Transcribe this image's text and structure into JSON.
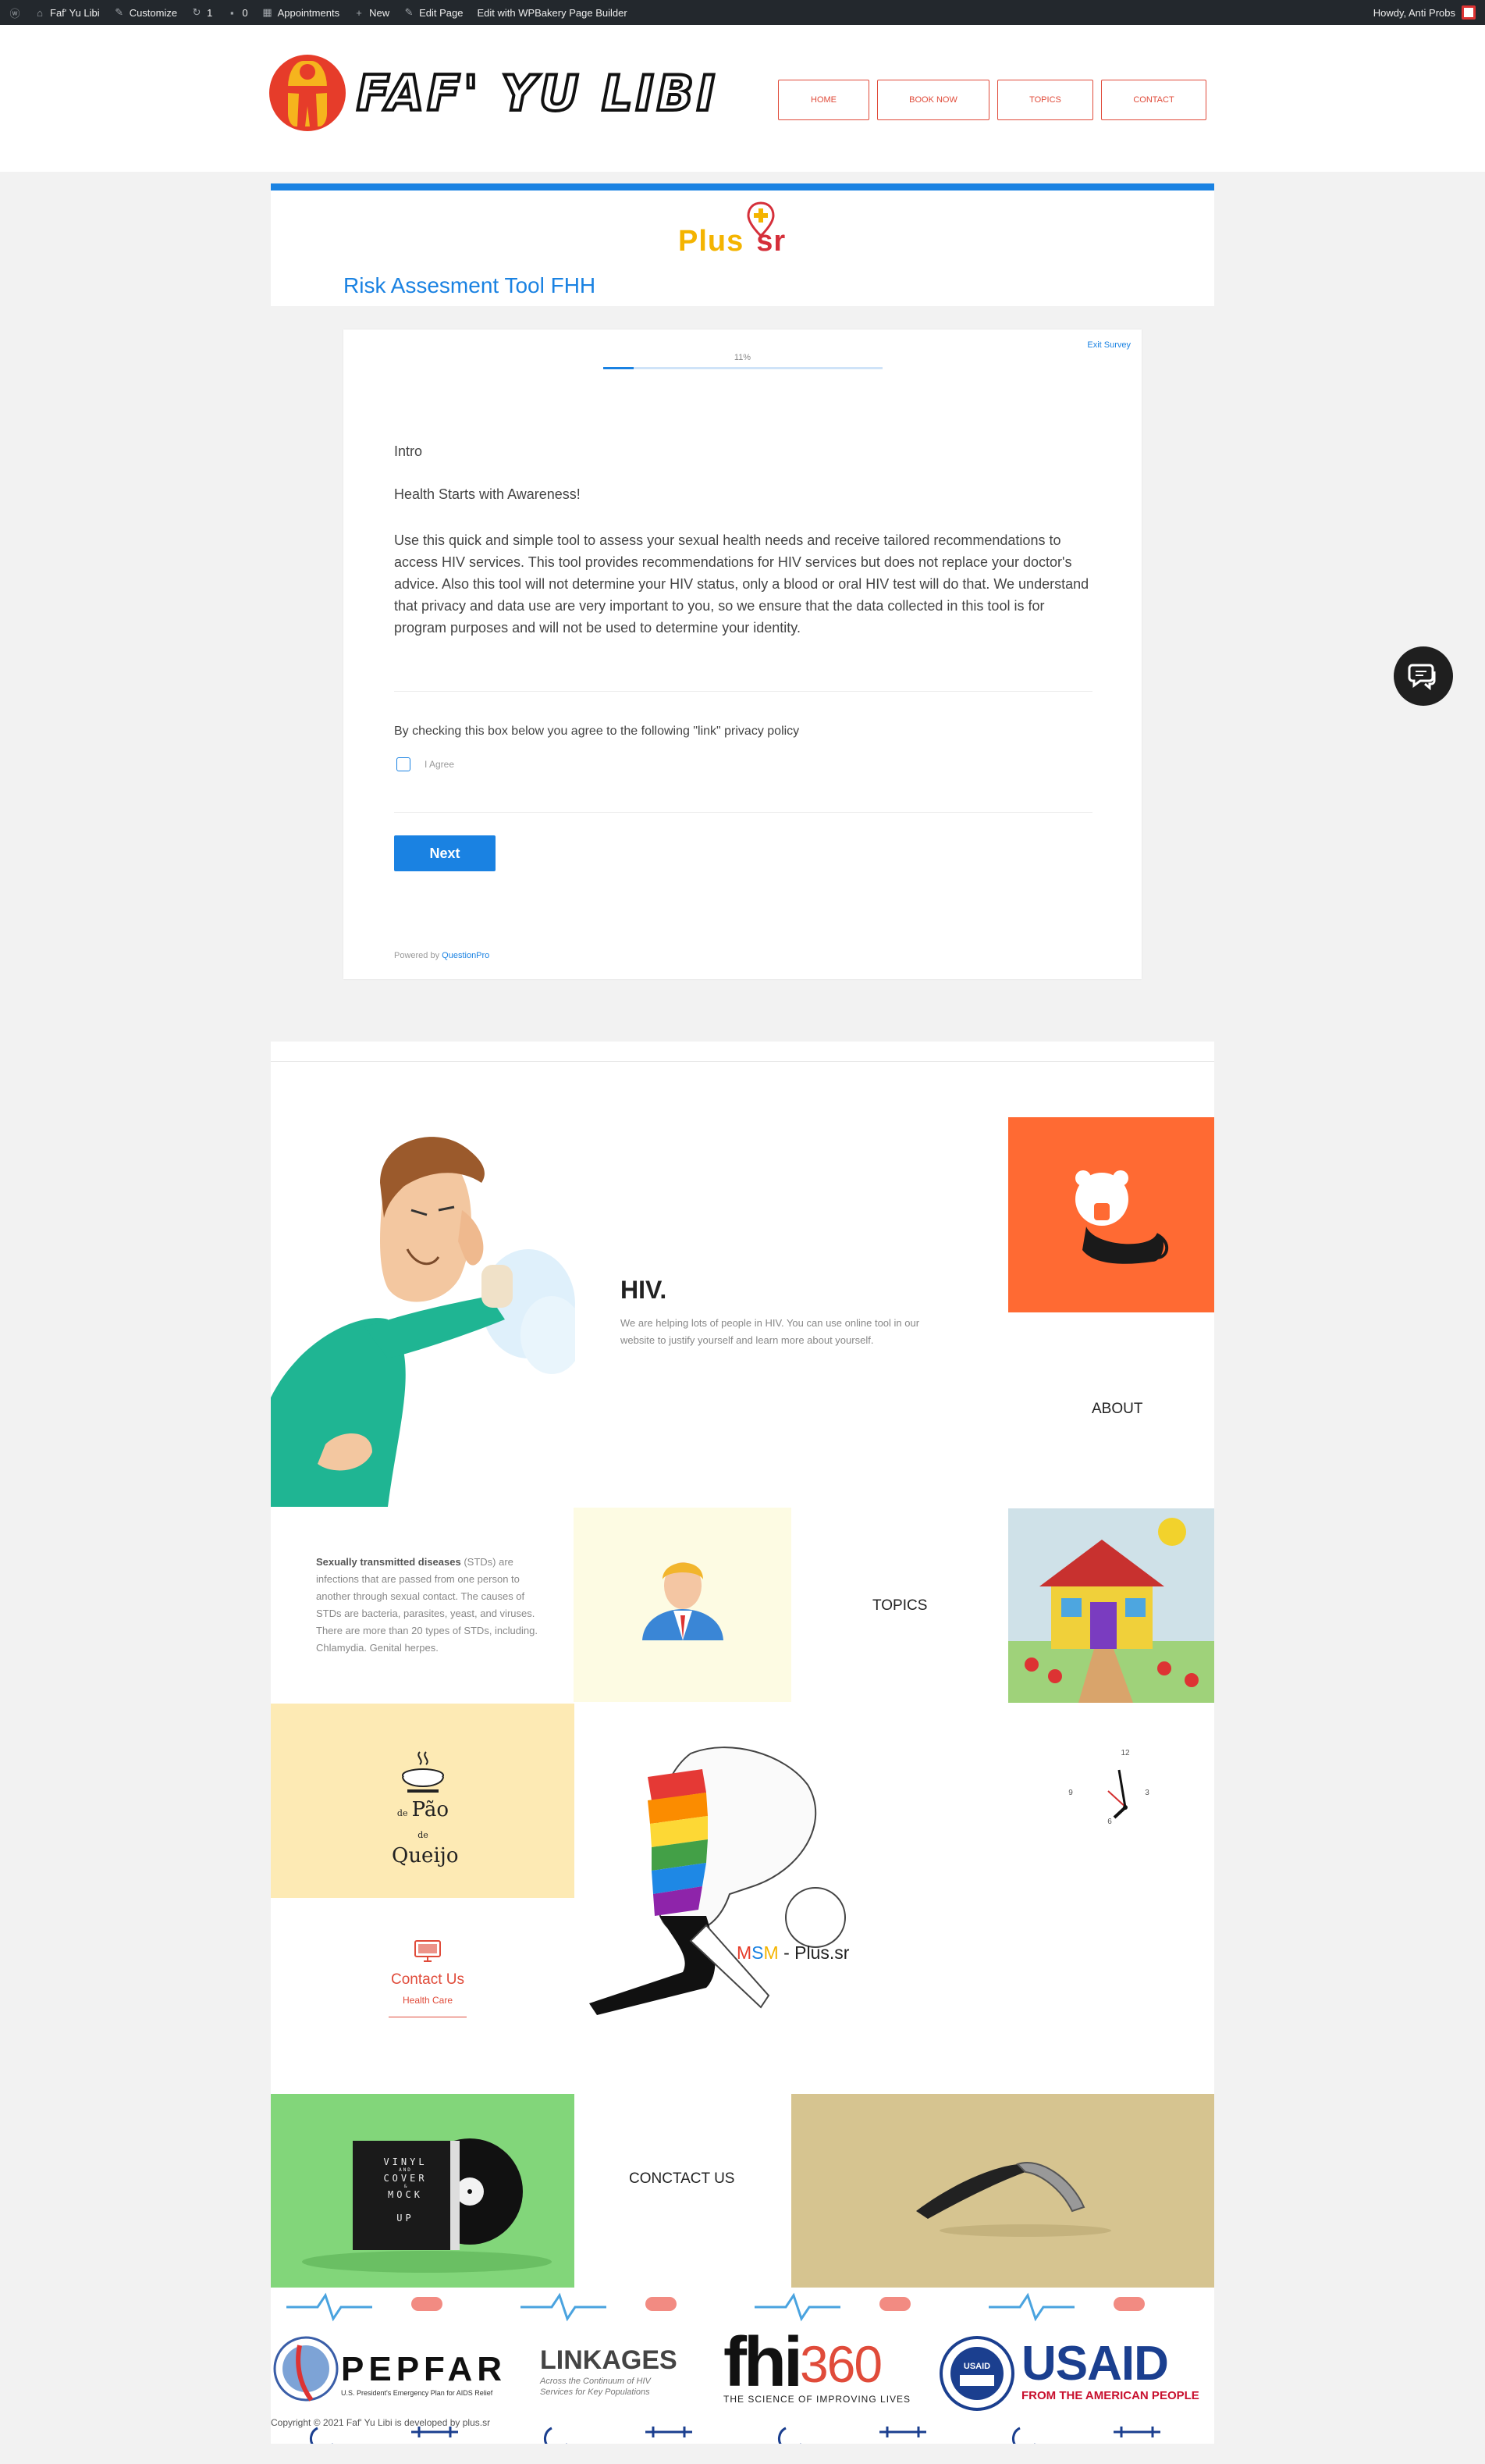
{
  "admin_bar": {
    "site_name": "Faf' Yu Libi",
    "customize": "Customize",
    "updates_count": "1",
    "comments_count": "0",
    "appointments": "Appointments",
    "new": "New",
    "edit_page": "Edit Page",
    "wpbakery": "Edit with WPBakery Page Builder",
    "howdy": "Howdy, Anti Probs"
  },
  "header": {
    "logo_text": "FAF' YU LIBI",
    "nav": [
      {
        "label": "HOME"
      },
      {
        "label": "BOOK NOW"
      },
      {
        "label": "TOPICS"
      },
      {
        "label": "CONTACT"
      }
    ]
  },
  "brand": {
    "plus_text": "Plus",
    "plus_suffix": "sr"
  },
  "page": {
    "title": "Risk Assesment Tool FHH"
  },
  "survey": {
    "exit_label": "Exit Survey",
    "progress_label": "11%",
    "progress_value": 0.11,
    "section": "Intro",
    "heading": "Health Starts with Awareness!",
    "body": "Use this quick and simple tool to assess your sexual health needs and receive tailored recommendations to access HIV services. This tool provides recommendations for HIV services but does not replace your doctor's advice. Also this tool will not determine your HIV status, only a blood or oral HIV test will do that. We understand that privacy and data use are very important to you, so we ensure that the data collected in this tool is for program purposes and will not be used to determine your identity.",
    "consent_text": "By checking this box below you agree to the following \"link\" privacy policy",
    "checkbox_label": "I Agree",
    "next_label": "Next",
    "powered_prefix": "Powered by",
    "powered_brand": "QuestionPro"
  },
  "grid": {
    "hiv_title": "HIV.",
    "hiv_text": "We are helping lots of people in HIV. You can use online tool in our website to justify yourself and learn more about yourself.",
    "about_label": "ABOUT",
    "std_bold": "Sexually transmitted diseases",
    "std_text": " (STDs) are infections that are passed from one person to another through sexual contact. The causes of STDs are bacteria, parasites, yeast, and viruses. There are more than 20 types of STDs, including. Chlamydia. Genital herpes.",
    "topics_label": "TOPICS",
    "pao_small": "de",
    "pao_big": "Pão",
    "pao_small2": "de",
    "queijo": "Queijo",
    "clock_12": "12",
    "clock_3": "3",
    "clock_6": "6",
    "clock_9": "9",
    "contact_title": "Contact Us",
    "contact_sub": "Health Care",
    "msm_m": "M",
    "msm_s": "S",
    "msm_m2": "M",
    "msm_rest": " - Plus.sr",
    "conctact_label": "CONCTACT US",
    "vinyl_lines": [
      "VINYL",
      "AND",
      "COVER",
      "&",
      "MOCK",
      "UP"
    ]
  },
  "sponsors": {
    "pepfar": "PEPFAR",
    "pepfar_sub": "U.S. President's Emergency Plan for AIDS Relief",
    "linkages": "LINKAGES",
    "linkages_sub1": "Across the Continuum of HIV",
    "linkages_sub2": "Services for Key Populations",
    "fhi": "fhi",
    "fhi_360": "360",
    "fhi_sub": "THE SCIENCE OF IMPROVING LIVES",
    "usaid": "USAID",
    "usaid_sub": "FROM THE AMERICAN PEOPLE",
    "usaid_seal": "USAID"
  },
  "footer": {
    "copyright": "Copyright © 2021 Faf' Yu Libi is developed by plus.sr"
  },
  "colors": {
    "accent_blue": "#1a82e2",
    "brand_red": "#e04b3a",
    "brand_yellow": "#f4b400",
    "orange_tile": "#ff6a33"
  }
}
